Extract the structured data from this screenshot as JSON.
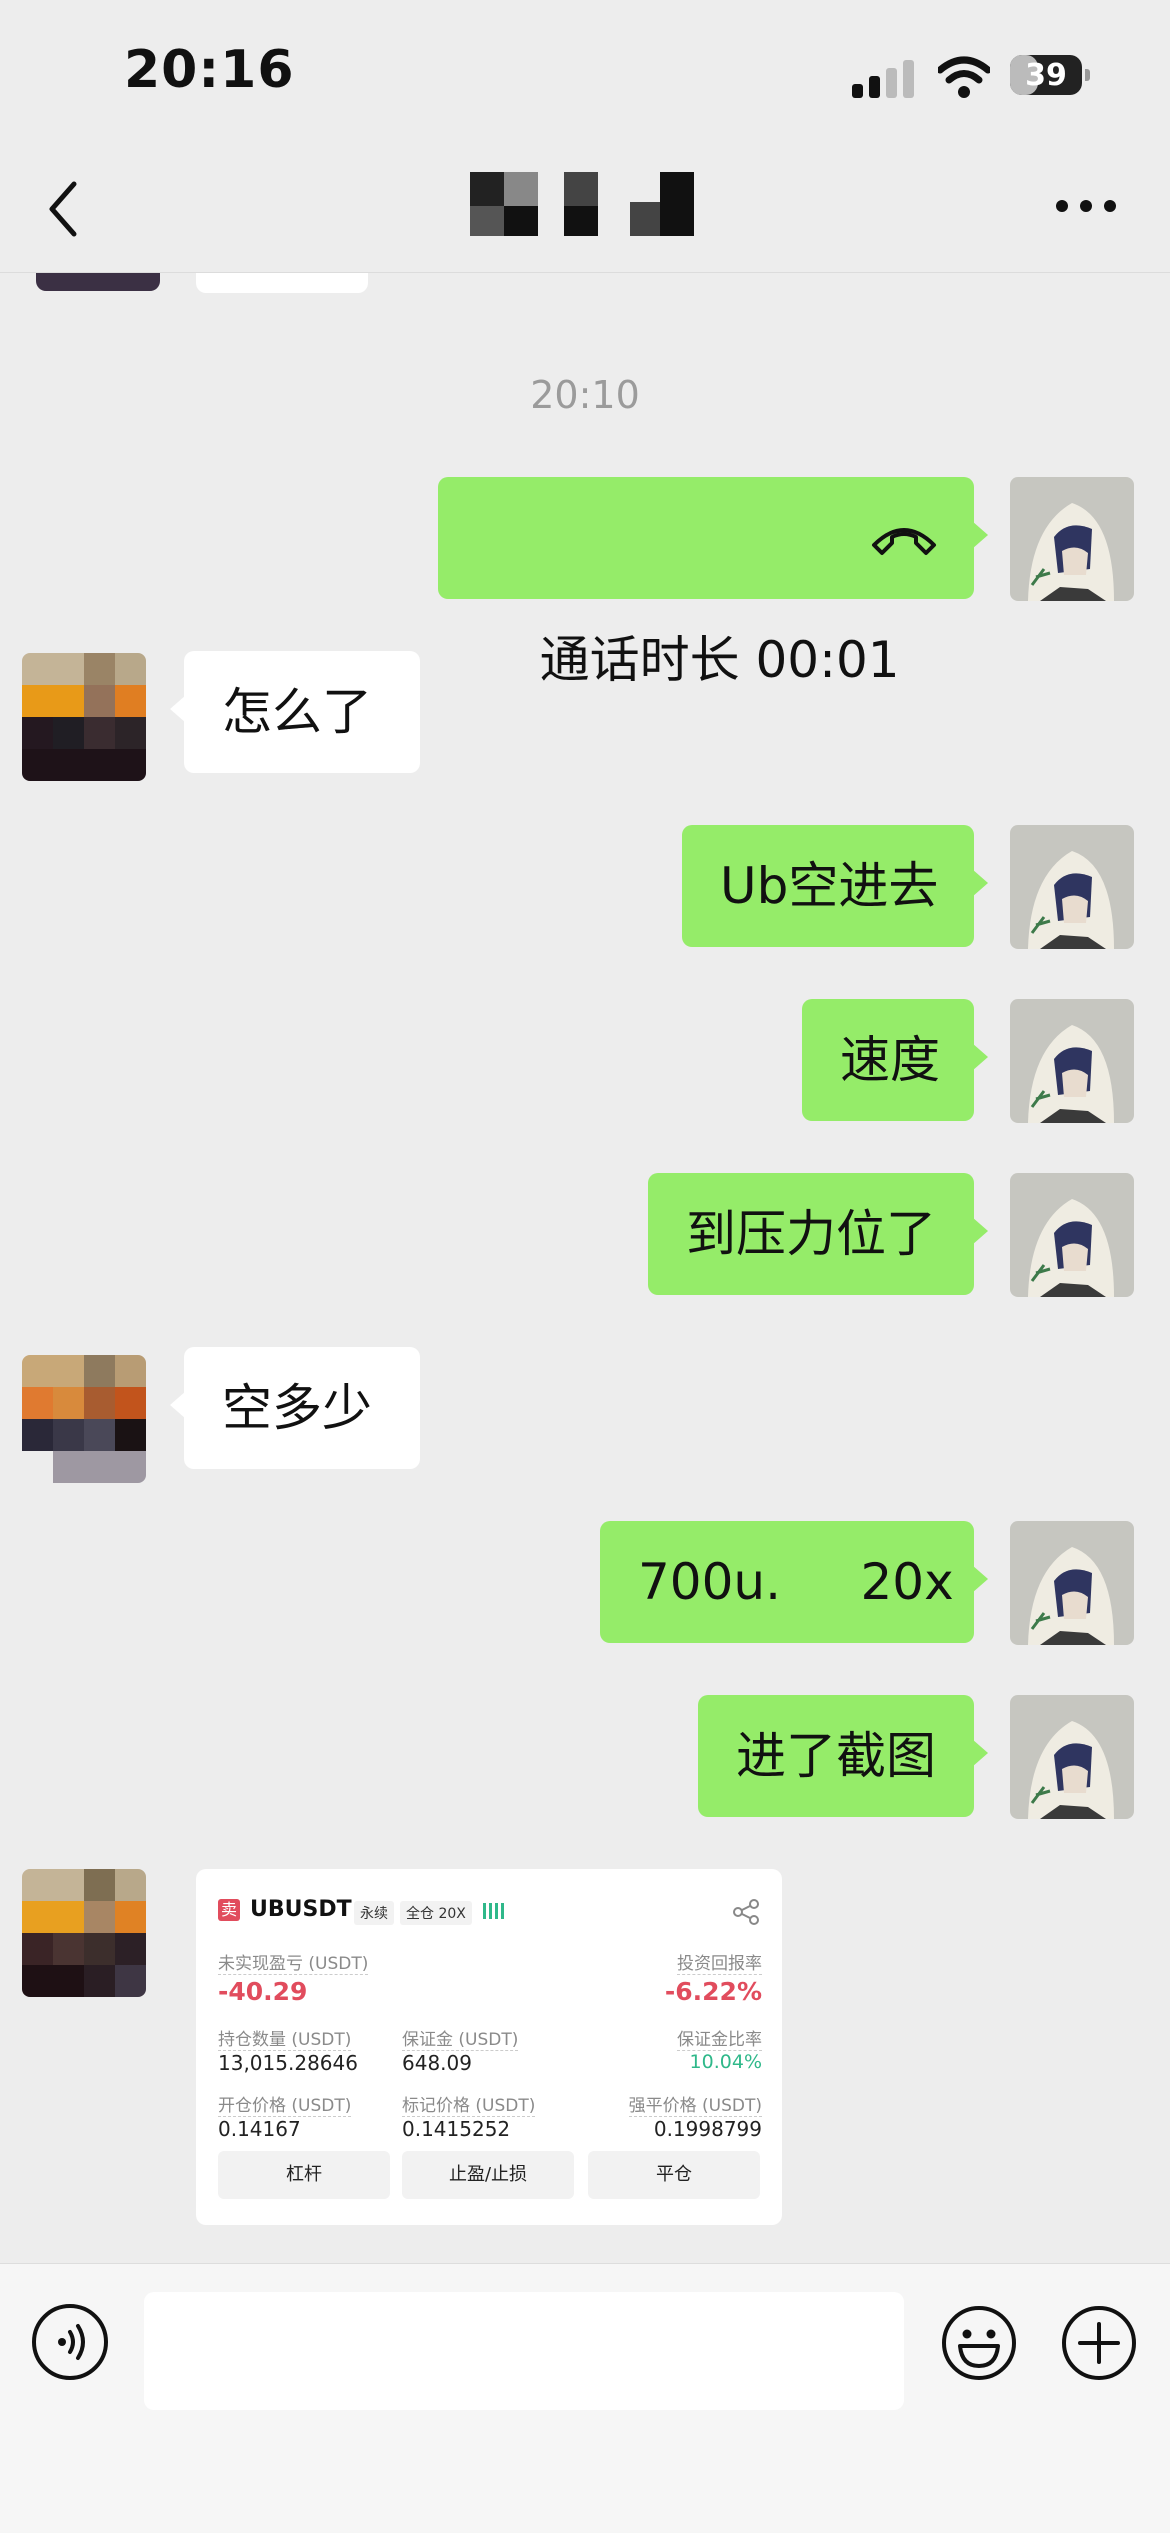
{
  "status_bar": {
    "time": "20:16",
    "battery": "39"
  },
  "header": {
    "back_label": "back",
    "more_label": "more"
  },
  "messages": {
    "timestamp": "20:10",
    "call": {
      "text": "通话时长 00:01"
    },
    "m1": "怎么了",
    "m2": "Ub空进去",
    "m3": "速度",
    "m4": "到压力位了",
    "m5": "空多少",
    "m6": "700u.     20x",
    "m7": "进了截图"
  },
  "trade_card": {
    "side_badge": "卖",
    "symbol": "UBUSDT",
    "contract_type": "永续",
    "margin_mode": "全仓 20X",
    "unrealized_pnl_label": "未实现盈亏 (USDT)",
    "unrealized_pnl": "-40.29",
    "roi_label": "投资回报率",
    "roi": "-6.22%",
    "position_qty_label": "持仓数量 (USDT)",
    "position_qty": "13,015.28646",
    "margin_label": "保证金 (USDT)",
    "margin": "648.09",
    "margin_ratio_label": "保证金比率",
    "margin_ratio": "10.04%",
    "entry_price_label": "开仓价格 (USDT)",
    "entry_price": "0.14167",
    "mark_price_label": "标记价格 (USDT)",
    "mark_price": "0.1415252",
    "liq_price_label": "强平价格 (USDT)",
    "liq_price": "0.1998799",
    "buttons": {
      "leverage": "杠杆",
      "tp_sl": "止盈/止损",
      "close": "平仓"
    }
  },
  "input_bar": {
    "placeholder": ""
  },
  "colors": {
    "my_bubble": "#95ec69",
    "other_bubble": "#ffffff",
    "background": "#ededed",
    "loss": "#e14c5d",
    "gain": "#2fb88a"
  }
}
